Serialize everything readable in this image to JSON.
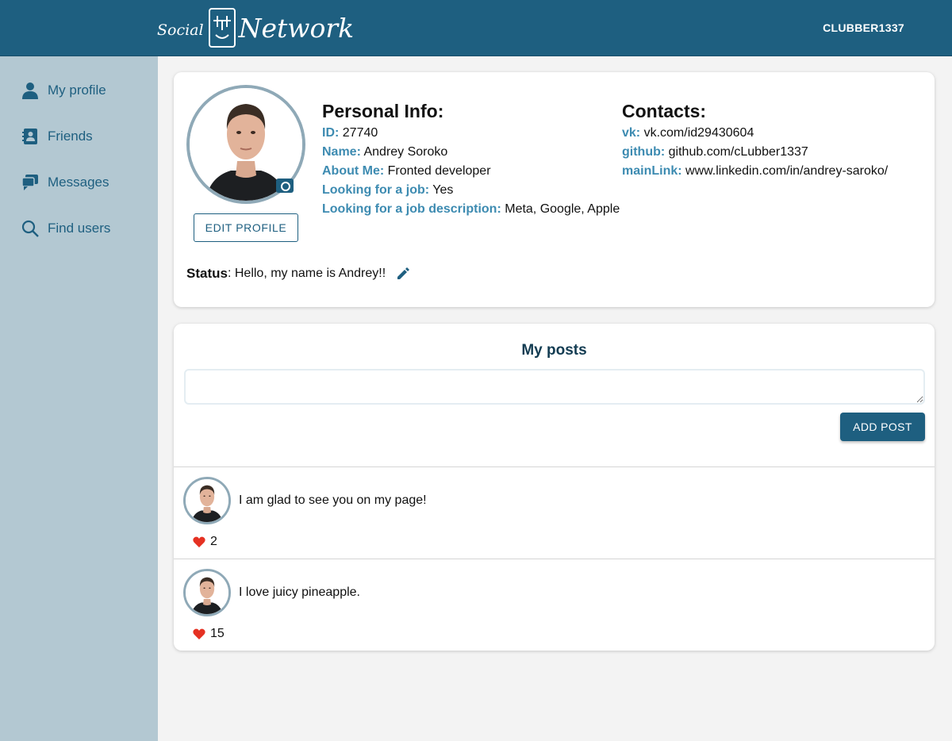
{
  "header": {
    "logo_word_1": "Social",
    "logo_word_2": "Network",
    "username": "CLUBBER1337"
  },
  "sidebar": {
    "items": [
      {
        "label": "My profile",
        "icon": "person-icon"
      },
      {
        "label": "Friends",
        "icon": "contacts-icon"
      },
      {
        "label": "Messages",
        "icon": "chat-icon"
      },
      {
        "label": "Find users",
        "icon": "search-icon"
      }
    ]
  },
  "profile": {
    "edit_button": "EDIT PROFILE",
    "personal_title": "Personal Info:",
    "personal_rows": [
      {
        "key": "ID:",
        "value": "27740"
      },
      {
        "key": "Name:",
        "value": "Andrey Soroko"
      },
      {
        "key": "About Me:",
        "value": "Fronted developer"
      },
      {
        "key": "Looking for a job:",
        "value": "Yes"
      },
      {
        "key": "Looking for a job description:",
        "value": "Meta, Google, Apple"
      }
    ],
    "contacts_title": "Contacts:",
    "contacts_rows": [
      {
        "key": "vk:",
        "value": "vk.com/id29430604"
      },
      {
        "key": "github:",
        "value": "github.com/cLubber1337"
      },
      {
        "key": "mainLink:",
        "value": "www.linkedin.com/in/andrey-saroko/"
      }
    ],
    "status_label": "Status",
    "status_text": ": Hello, my name is Andrey!!"
  },
  "posts": {
    "title": "My posts",
    "input_value": "",
    "add_button": "ADD POST",
    "items": [
      {
        "text": "I am glad to see you on my page!",
        "likes": "2"
      },
      {
        "text": "I love juicy pineapple.",
        "likes": "15"
      }
    ]
  },
  "colors": {
    "header_bg": "#1e5f80",
    "sidebar_bg": "#b3c8d2",
    "accent": "#3d8bb1",
    "heart": "#e53122"
  }
}
